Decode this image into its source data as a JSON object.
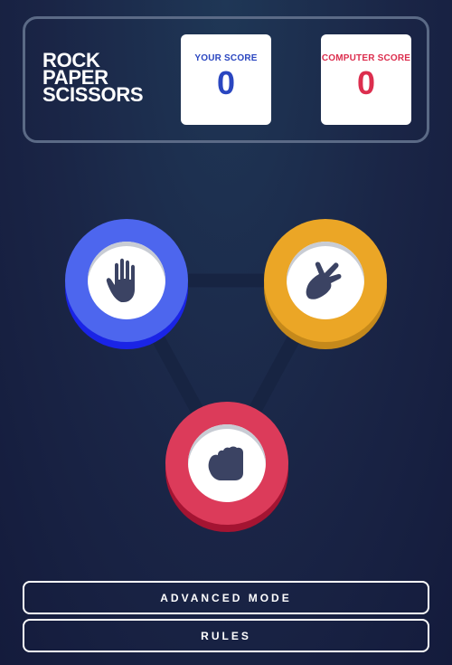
{
  "header": {
    "title_lines": [
      "ROCK",
      "PAPER",
      "SCISSORS"
    ],
    "your_score": {
      "label": "YOUR SCORE",
      "value": "0"
    },
    "computer_score": {
      "label": "COMPUTER SCORE",
      "value": "0"
    }
  },
  "choices": [
    {
      "id": "paper",
      "icon": "paper-hand-icon",
      "color": "#4d66ee"
    },
    {
      "id": "scissors",
      "icon": "scissors-hand-icon",
      "color": "#eba626"
    },
    {
      "id": "rock",
      "icon": "rock-fist-icon",
      "color": "#dc3b5a"
    }
  ],
  "buttons": {
    "advanced_mode": "ADVANCED MODE",
    "rules": "RULES"
  }
}
